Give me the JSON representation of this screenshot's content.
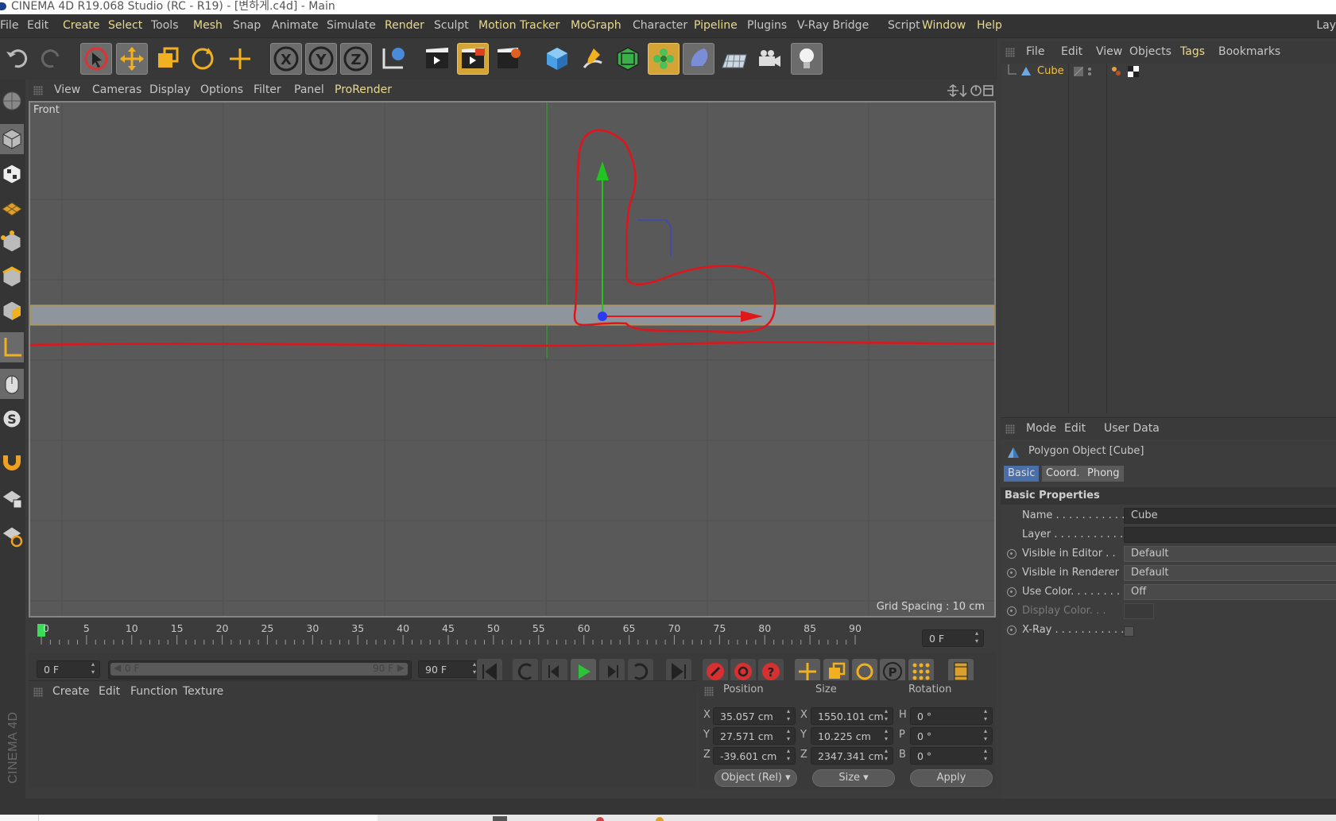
{
  "window": {
    "title": "CINEMA 4D R19.068 Studio (RC - R19) - [변하게.c4d] - Main",
    "right_cut_label": "Lay"
  },
  "menubar": [
    {
      "label": "File",
      "hl": false
    },
    {
      "label": "Edit",
      "hl": false
    },
    {
      "label": "Create",
      "hl": true
    },
    {
      "label": "Select",
      "hl": true
    },
    {
      "label": "Tools",
      "hl": false
    },
    {
      "label": "Mesh",
      "hl": true
    },
    {
      "label": "Snap",
      "hl": false
    },
    {
      "label": "Animate",
      "hl": false
    },
    {
      "label": "Simulate",
      "hl": false
    },
    {
      "label": "Render",
      "hl": true
    },
    {
      "label": "Sculpt",
      "hl": false
    },
    {
      "label": "Motion Tracker",
      "hl": true
    },
    {
      "label": "MoGraph",
      "hl": true
    },
    {
      "label": "Character",
      "hl": false
    },
    {
      "label": "Pipeline",
      "hl": true
    },
    {
      "label": "Plugins",
      "hl": false
    },
    {
      "label": "V-Ray Bridge",
      "hl": false
    },
    {
      "label": "Script",
      "hl": false
    },
    {
      "label": "Window",
      "hl": true
    },
    {
      "label": "Help",
      "hl": true
    }
  ],
  "toolbar": {
    "buttons": [
      "undo-icon",
      "redo-icon",
      "live-select-icon",
      "move-icon",
      "scale-icon",
      "rotate-icon",
      "recent-tool-icon",
      "x-axis-icon",
      "y-axis-icon",
      "z-axis-icon",
      "coordinate-system-icon",
      "render-view-icon",
      "render-picture-viewer-icon",
      "render-settings-icon",
      "cube-icon",
      "pen-icon",
      "subdivision-icon",
      "cloner-icon",
      "deformer-icon",
      "floor-icon",
      "camera-icon",
      "light-icon"
    ]
  },
  "viewport": {
    "menu": [
      {
        "label": "View",
        "hl": false
      },
      {
        "label": "Cameras",
        "hl": false
      },
      {
        "label": "Display",
        "hl": false
      },
      {
        "label": "Options",
        "hl": false
      },
      {
        "label": "Filter",
        "hl": false
      },
      {
        "label": "Panel",
        "hl": false
      },
      {
        "label": "ProRender",
        "hl": true
      }
    ],
    "label": "Front",
    "grid_spacing": "Grid Spacing : 10 cm",
    "colors": {
      "background": "#595959",
      "object": "#8f959c",
      "annotation": "#e0141a",
      "y_axis": "#22bb22",
      "x_axis": "#e01818"
    }
  },
  "timeline": {
    "ticks": [
      "0",
      "5",
      "10",
      "15",
      "20",
      "25",
      "30",
      "35",
      "40",
      "45",
      "50",
      "55",
      "60",
      "65",
      "70",
      "75",
      "80",
      "85",
      "90"
    ],
    "current_frame": "0 F",
    "start_field": "0 F",
    "slider_start": "0 F",
    "slider_end": "90 F",
    "end_field": "90 F"
  },
  "material_manager": {
    "menu": [
      "Create",
      "Edit",
      "Function",
      "Texture"
    ]
  },
  "coordinates": {
    "headers": [
      "Position",
      "Size",
      "Rotation"
    ],
    "rows": [
      {
        "axis": "X",
        "pos": "35.057 cm",
        "size_axis": "X",
        "size": "1550.101 cm",
        "rot_axis": "H",
        "rot": "0 °"
      },
      {
        "axis": "Y",
        "pos": "27.571 cm",
        "size_axis": "Y",
        "size": "10.225 cm",
        "rot_axis": "P",
        "rot": "0 °"
      },
      {
        "axis": "Z",
        "pos": "-39.601 cm",
        "size_axis": "Z",
        "size": "2347.341 cm",
        "rot_axis": "B",
        "rot": "0 °"
      }
    ],
    "mode_dropdown": "Object (Rel)",
    "size_dropdown": "Size",
    "apply_label": "Apply"
  },
  "object_manager": {
    "menu": [
      {
        "label": "File",
        "hl": false
      },
      {
        "label": "Edit",
        "hl": false
      },
      {
        "label": "View",
        "hl": false
      },
      {
        "label": "Objects",
        "hl": false
      },
      {
        "label": "Tags",
        "hl": true
      },
      {
        "label": "Bookmarks",
        "hl": false
      }
    ],
    "objects": [
      {
        "name": "Cube"
      }
    ]
  },
  "attribute_manager": {
    "menu": [
      "Mode",
      "Edit",
      "User Data"
    ],
    "object_title": "Polygon Object [Cube]",
    "tabs": [
      {
        "label": "Basic",
        "active": true
      },
      {
        "label": "Coord.",
        "active": false
      },
      {
        "label": "Phong",
        "active": false
      }
    ],
    "section": "Basic Properties",
    "rows": [
      {
        "label": "Name . . . . . . . . . . .",
        "value": "Cube",
        "radio": false,
        "dd": false,
        "dim": false
      },
      {
        "label": "Layer . . . . . . . . . . .",
        "value": "",
        "radio": false,
        "dd": false,
        "dim": false
      },
      {
        "label": "Visible in Editor . .",
        "value": "Default",
        "radio": true,
        "dd": true,
        "dim": false
      },
      {
        "label": "Visible in Renderer",
        "value": "Default",
        "radio": true,
        "dd": true,
        "dim": false
      },
      {
        "label": "Use Color. . . . . . . .",
        "value": "Off",
        "radio": true,
        "dd": true,
        "dim": false
      },
      {
        "label": "Display Color. . .",
        "value": "",
        "radio": true,
        "dd": false,
        "dim": true
      },
      {
        "label": "X-Ray . . . . . . . . . . .",
        "value": "",
        "radio": true,
        "dd": false,
        "dim": false,
        "checkbox": true
      }
    ]
  },
  "brand": "CINEMA 4D"
}
